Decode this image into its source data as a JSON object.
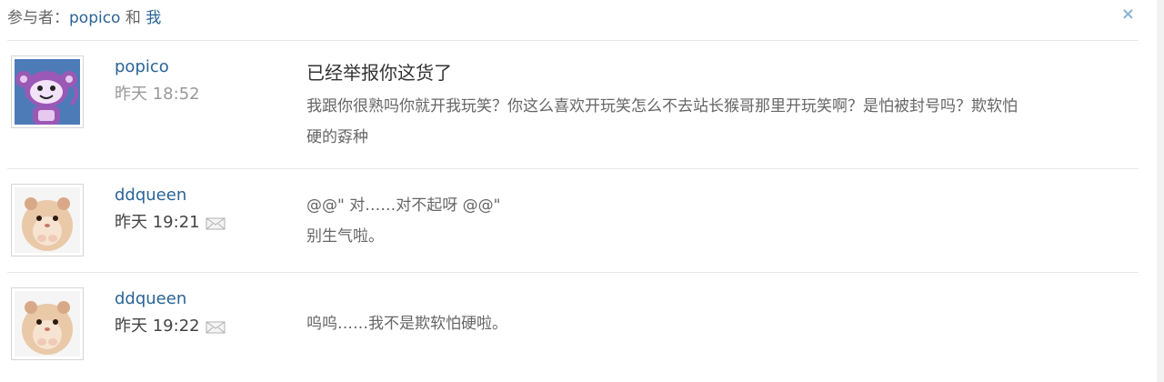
{
  "header": {
    "prefix": "参与者：",
    "participant_1": "popico",
    "conjunction": "和",
    "participant_2": "我",
    "close_glyph": "×"
  },
  "messages": [
    {
      "author": "popico",
      "time": "昨天 18:52",
      "subject": "已经举报你这货了",
      "lines": [
        "我跟你很熟吗你就开我玩笑？你这么喜欢开玩笑怎么不去站长猴哥那里开玩笑啊？是怕被封号吗？欺软怕",
        "硬的孬种"
      ],
      "avatar": "purple-monkey-avatar",
      "has_envelope": false
    },
    {
      "author": "ddqueen",
      "time": "昨天 19:21",
      "lines": [
        "@@\" 对……对不起呀 @@\"",
        "别生气啦。"
      ],
      "avatar": "hamster-avatar",
      "has_envelope": true
    },
    {
      "author": "ddqueen",
      "time": "昨天 19:22",
      "lines": [
        "呜呜……我不是欺软怕硬啦。"
      ],
      "avatar": "hamster-avatar",
      "has_envelope": true
    }
  ],
  "colors": {
    "link": "#2a6496",
    "muted": "#999999",
    "divider": "#e8e8e8"
  }
}
